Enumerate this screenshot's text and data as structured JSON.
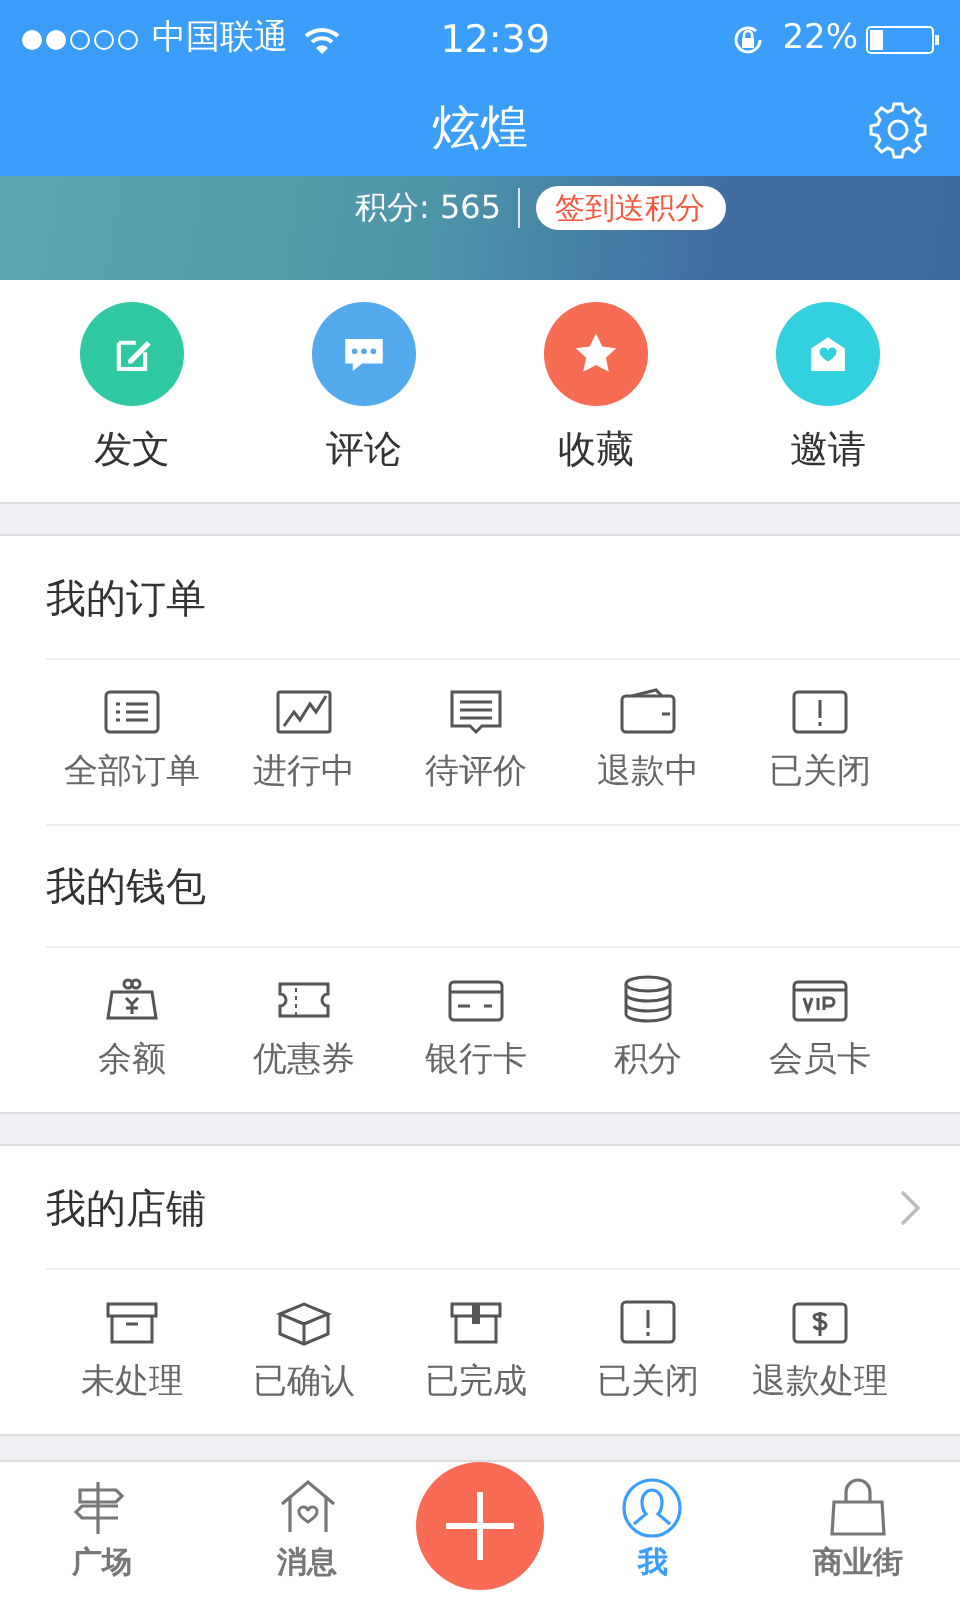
{
  "status_bar": {
    "carrier": "中国联通",
    "time": "12:39",
    "battery": "22%"
  },
  "nav": {
    "title": "炫煌"
  },
  "banner": {
    "points": "积分: 565",
    "checkin_button": "签到送积分"
  },
  "quick_actions": [
    {
      "label": "发文",
      "color": "#2ec9a2"
    },
    {
      "label": "评论",
      "color": "#52a9ec"
    },
    {
      "label": "收藏",
      "color": "#f76c52"
    },
    {
      "label": "邀请",
      "color": "#33d0e0"
    }
  ],
  "sections": [
    {
      "title": "我的订单",
      "has_arrow": false,
      "items": [
        {
          "label": "全部订单"
        },
        {
          "label": "进行中"
        },
        {
          "label": "待评价"
        },
        {
          "label": "退款中"
        },
        {
          "label": "已关闭"
        }
      ]
    },
    {
      "title": "我的钱包",
      "has_arrow": false,
      "items": [
        {
          "label": "余额"
        },
        {
          "label": "优惠券"
        },
        {
          "label": "银行卡"
        },
        {
          "label": "积分"
        },
        {
          "label": "会员卡"
        }
      ]
    },
    {
      "title": "我的店铺",
      "has_arrow": true,
      "items": [
        {
          "label": "未处理"
        },
        {
          "label": "已确认"
        },
        {
          "label": "已完成"
        },
        {
          "label": "已关闭"
        },
        {
          "label": "退款处理"
        }
      ]
    }
  ],
  "tab_bar": [
    {
      "label": "广场",
      "selected": false
    },
    {
      "label": "消息",
      "selected": false
    },
    {
      "label": "我",
      "selected": true
    },
    {
      "label": "商业街",
      "selected": false
    }
  ]
}
